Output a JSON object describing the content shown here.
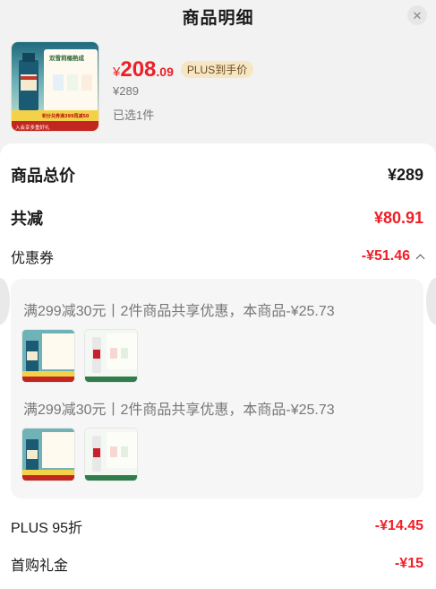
{
  "header": {
    "title": "商品明细",
    "close_icon": "close-icon"
  },
  "product": {
    "image_brand_text": "DIAGEO",
    "image_headline": "双雪莉桶熟成",
    "image_promo": "积分兑券满399再减50",
    "image_footer": "入会享多重好礼",
    "price_currency": "¥",
    "price_int": "208",
    "price_dec": ".09",
    "plus_tag": "PLUS到手价",
    "original_price": "¥289",
    "selected_count": "已选1件"
  },
  "details": {
    "total_label": "商品总价",
    "total_value": "¥289",
    "discount_label": "共减",
    "discount_value": "¥80.91",
    "coupon_label": "优惠券",
    "coupon_value": "-¥51.46",
    "coupons": [
      {
        "text": "满299减30元丨2件商品共享优惠，本商品-¥25.73"
      },
      {
        "text": "满299减30元丨2件商品共享优惠，本商品-¥25.73"
      }
    ],
    "plus_label": "PLUS 95折",
    "plus_value": "-¥14.45",
    "first_label": "首购礼金",
    "first_value": "-¥15"
  },
  "colors": {
    "accent_red": "#ee1f26",
    "plus_gold": "#f6e6c3"
  }
}
